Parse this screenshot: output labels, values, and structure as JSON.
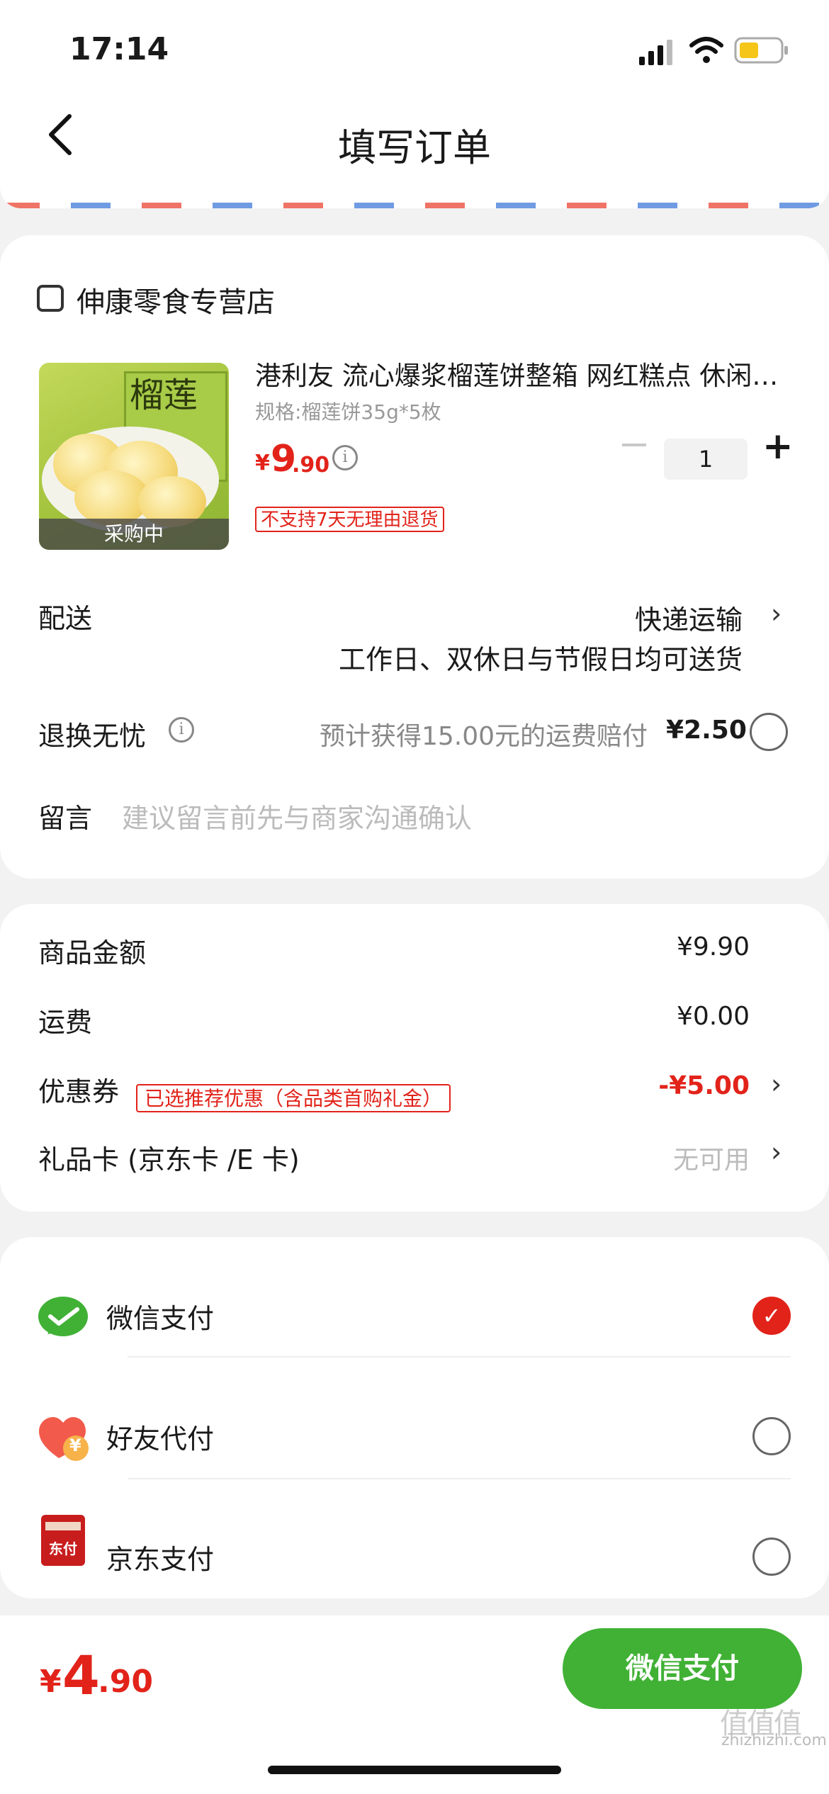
{
  "status_bar": {
    "time": "17:14"
  },
  "header": {
    "title": "填写订单"
  },
  "store": {
    "name": "伸康零食专营店"
  },
  "product": {
    "title": "港利友 流心爆浆榴莲饼整箱 网红糕点 休闲零食",
    "spec": "规格:榴莲饼35g*5枚",
    "price_currency": "¥",
    "price_int": "9",
    "price_dec": ".90",
    "quantity": "1",
    "image_badge": "采购中",
    "image_text": "榴莲",
    "return_tag": "不支持7天无理由退货"
  },
  "delivery": {
    "label": "配送",
    "method": "快递运输",
    "note": "工作日、双休日与节假日均可送货"
  },
  "insurance": {
    "label": "退换无忧",
    "desc": "预计获得15.00元的运费赔付",
    "price": "¥2.50"
  },
  "message": {
    "label": "留言",
    "placeholder": "建议留言前先与商家沟通确认"
  },
  "summary": {
    "goods_label": "商品金额",
    "goods_value": "¥9.90",
    "shipping_label": "运费",
    "shipping_value": "¥0.00",
    "coupon_label": "优惠券",
    "coupon_tag": "已选推荐优惠（含品类首购礼金）",
    "coupon_value": "-¥5.00",
    "giftcard_label": "礼品卡 (京东卡 /E 卡)",
    "giftcard_value": "无可用"
  },
  "payment": {
    "methods": [
      {
        "label": "微信支付",
        "selected": true
      },
      {
        "label": "好友代付",
        "selected": false
      },
      {
        "label": "京东支付",
        "selected": false
      }
    ],
    "jd_icon_text": "东付",
    "friend_icon_text": "¥"
  },
  "bottom": {
    "total_currency": "¥",
    "total_int": "4",
    "total_dec": ".90",
    "pay_button": "微信支付"
  },
  "watermark": {
    "glyphs": "值值值",
    "url": "zhizhizhi.com"
  },
  "colors": {
    "accent_red": "#e2231a",
    "wechat_green": "#40b135"
  }
}
